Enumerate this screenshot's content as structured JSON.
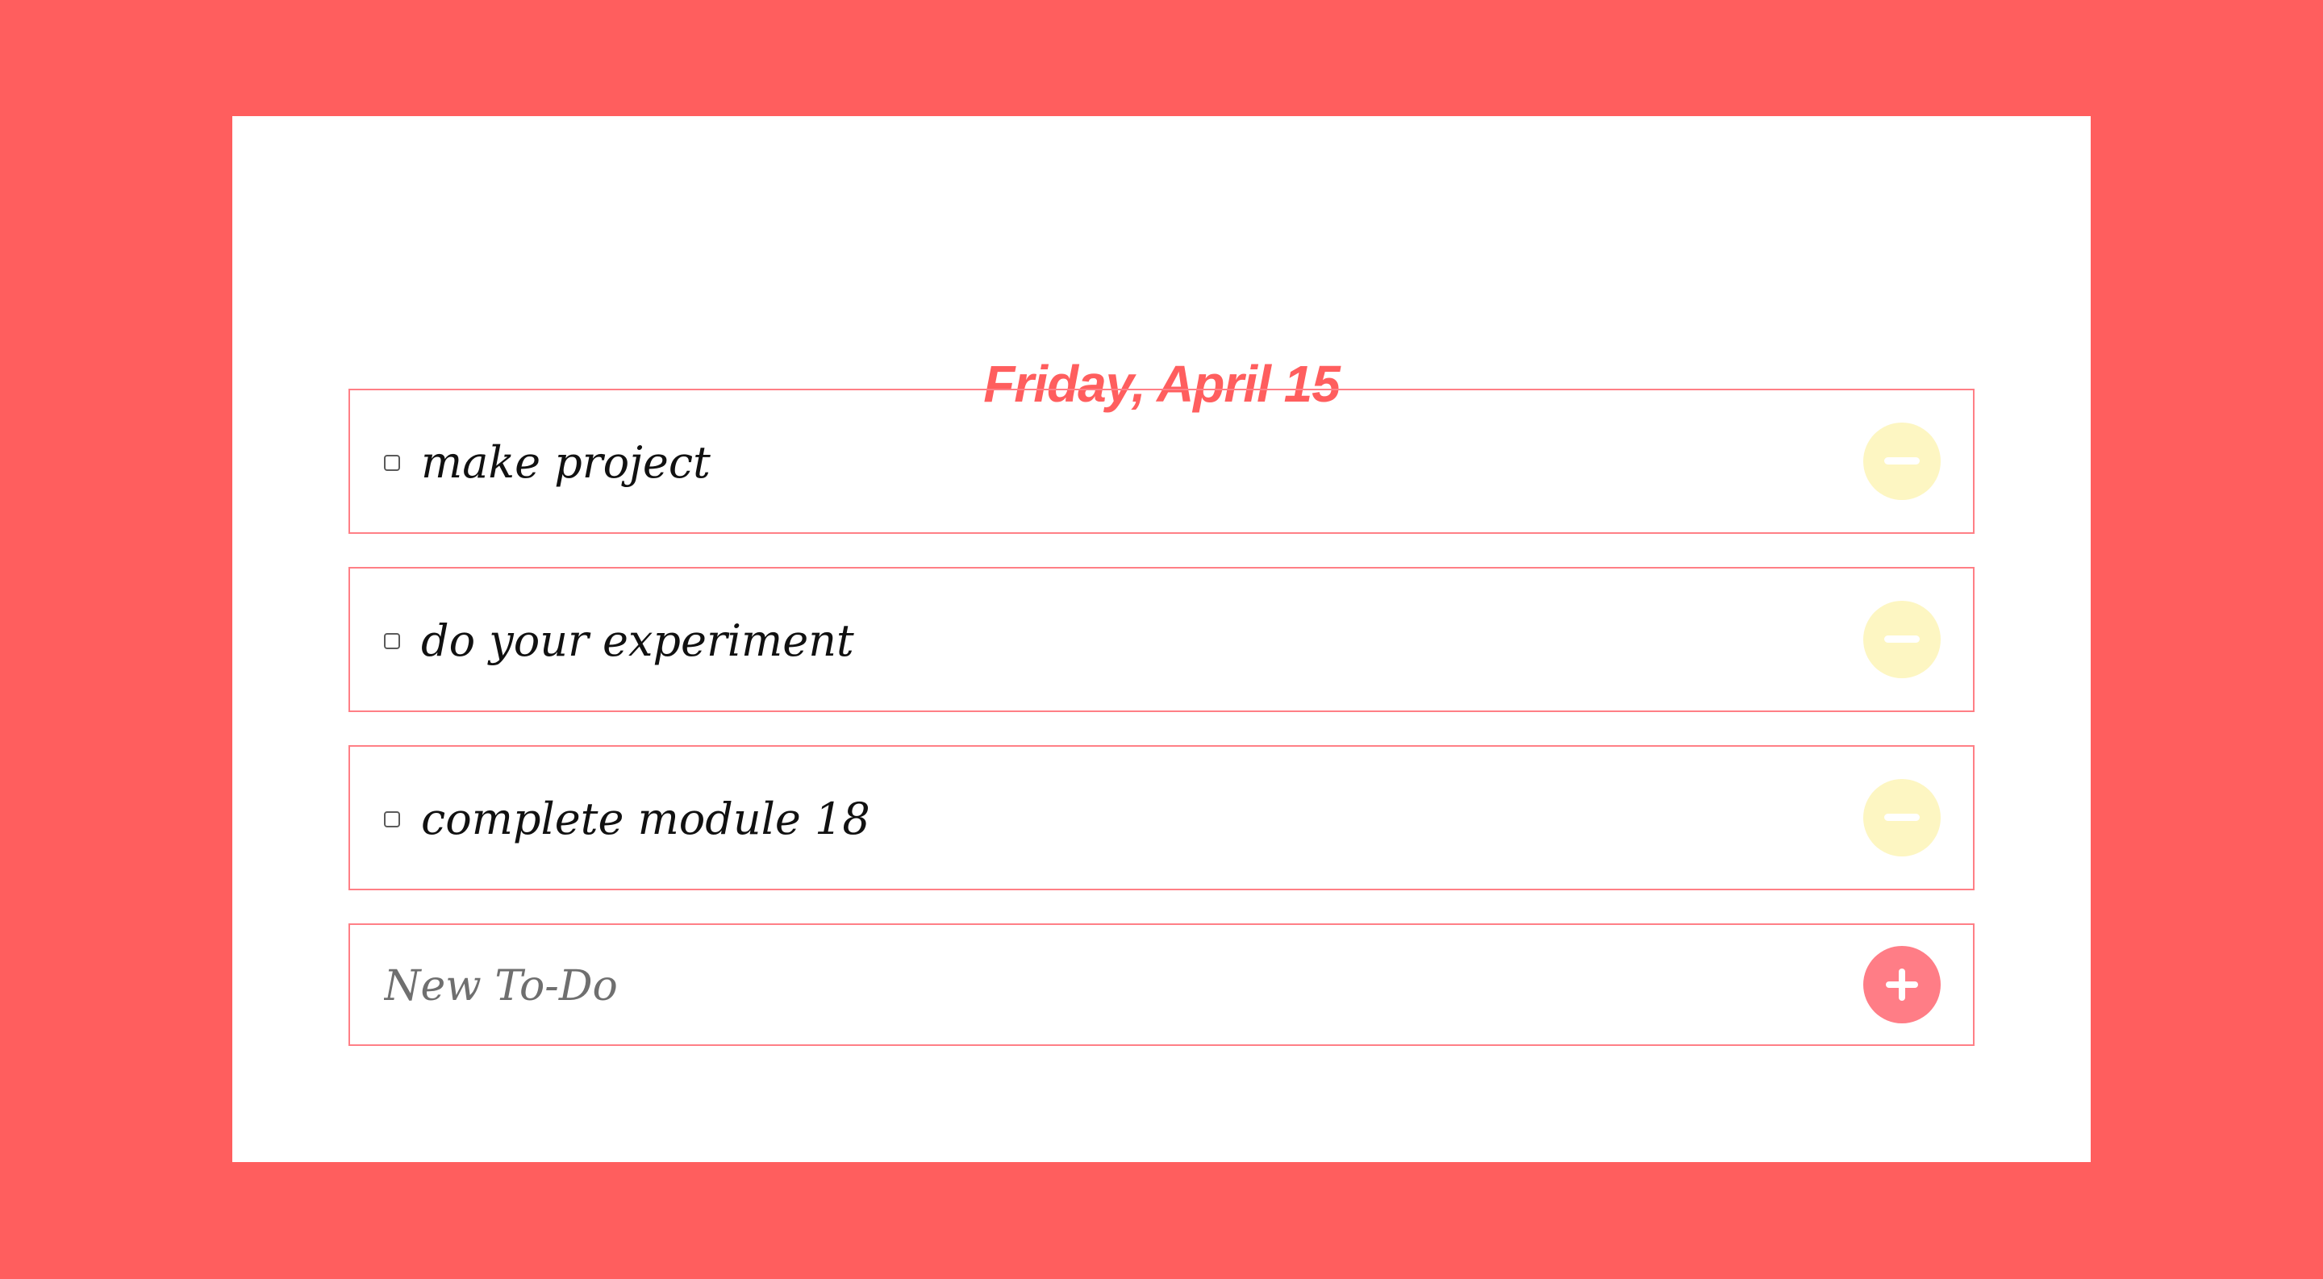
{
  "app": {
    "date_title": "Friday, April 15"
  },
  "todos": [
    {
      "label": "make project",
      "checked": false,
      "remove_icon": "minus-icon"
    },
    {
      "label": "do your experiment",
      "checked": false,
      "remove_icon": "minus-icon"
    },
    {
      "label": "complete module 18",
      "checked": false,
      "remove_icon": "minus-icon"
    }
  ],
  "new_todo": {
    "placeholder": "New To-Do",
    "value": "",
    "add_icon": "plus-icon"
  },
  "colors": {
    "background": "#ff5e5e",
    "card": "#ffffff",
    "title": "#ff5e5e",
    "row_border": "#ff7f86",
    "remove_button": "#fdf6c2",
    "add_button": "#ff7d86"
  }
}
